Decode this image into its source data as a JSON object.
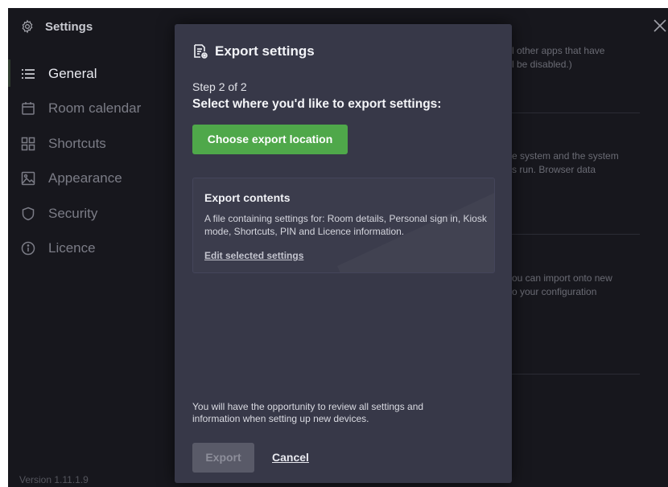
{
  "window": {
    "title": "Settings",
    "title_icon": "gear-icon",
    "close_icon": "close-icon"
  },
  "sidebar": {
    "items": [
      {
        "label": "General",
        "icon": "list-icon",
        "active": true
      },
      {
        "label": "Room calendar",
        "icon": "calendar-icon",
        "active": false
      },
      {
        "label": "Shortcuts",
        "icon": "grid-icon",
        "active": false
      },
      {
        "label": "Appearance",
        "icon": "image-icon",
        "active": false
      },
      {
        "label": "Security",
        "icon": "shield-icon",
        "active": false
      },
      {
        "label": "Licence",
        "icon": "info-icon",
        "active": false
      }
    ],
    "version": "Version 1.11.1.9"
  },
  "background": {
    "text1_line1": "l other apps that have",
    "text1_line2": "l be disabled.)",
    "text2_line1": "e system and the system",
    "text2_line2": "s run. Browser data",
    "text3_line1": "ou can import onto new",
    "text3_line2": "o your configuration"
  },
  "modal": {
    "title": "Export settings",
    "title_icon": "export-document-icon",
    "step": "Step 2 of 2",
    "heading": "Select where you'd like to export settings:",
    "choose_button": "Choose export location",
    "contents": {
      "title": "Export contents",
      "description": "A file containing settings for: Room details, Personal sign in, Kiosk mode, Shortcuts, PIN and Licence information.",
      "edit_link": "Edit selected settings"
    },
    "footnote": "You will have the opportunity to review all settings and information when setting up new devices.",
    "export_button": "Export",
    "cancel_link": "Cancel"
  },
  "colors": {
    "app_background": "#17171d",
    "modal_background": "#373848",
    "accent_green": "#4fa84a",
    "disabled_button": "#595a68"
  }
}
